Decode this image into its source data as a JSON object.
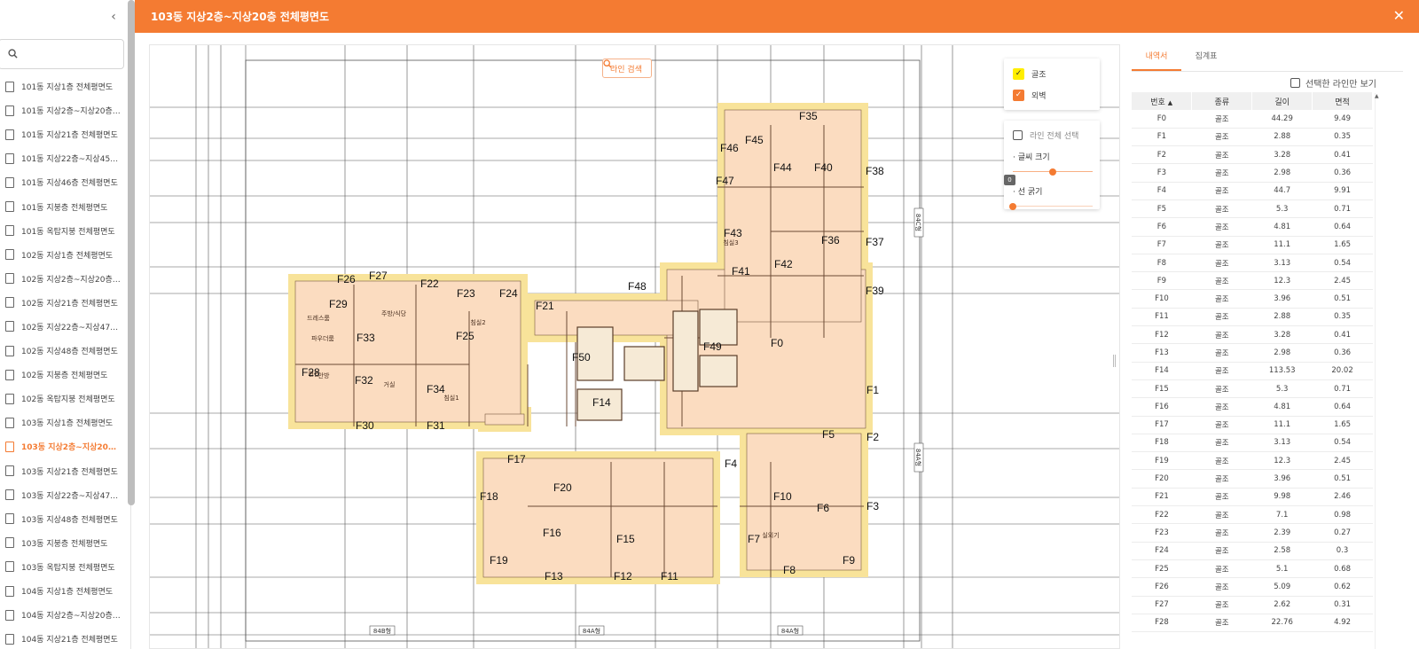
{
  "header": {
    "title": "103동 지상2층~지상20층 전체평면도",
    "close_icon": "close-icon"
  },
  "sidebar": {
    "collapse_icon": "chevron-left-icon",
    "search": {
      "placeholder": "",
      "value": ""
    },
    "items": [
      "101동 지상1층 전체평면도",
      "101동 지상2층~지상20층 전체평면도",
      "101동 지상21층 전체평면도",
      "101동 지상22층~지상45층 전체평면도",
      "101동 지상46층 전체평면도",
      "101동 지붕층 전체평면도",
      "101동 옥탑지붕 전체평면도",
      "102동 지상1층 전체평면도",
      "102동 지상2층~지상20층 전체평면도",
      "102동 지상21층 전체평면도",
      "102동 지상22층~지상47층 전체평면도",
      "102동 지상48층 전체평면도",
      "102동 지붕층 전체평면도",
      "102동 옥탑지붕 전체평면도",
      "103동 지상1층 전체평면도",
      "103동 지상2층~지상20층 전체평면도",
      "103동 지상21층 전체평면도",
      "103동 지상22층~지상47층 전체평면도",
      "103동 지상48층 전체평면도",
      "103동 지붕층 전체평면도",
      "103동 옥탑지붕 전체평면도",
      "104동 지상1층 전체평면도",
      "104동 지상2층~지상20층 전체평면도",
      "104동 지상21층 전체평면도"
    ],
    "active_index": 15
  },
  "drawing": {
    "line_search_label": "라인 검색",
    "legend": [
      {
        "label": "골조",
        "color": "#ffee00",
        "checked": true
      },
      {
        "label": "외벽",
        "color": "#f47b32",
        "checked": true
      }
    ],
    "select_all_label": "라인 전체 선택",
    "font_size_label": "· 글씨 크기",
    "font_size_value": 0.5,
    "line_width_label": "· 선 굵기",
    "line_width_value": 0,
    "line_width_tip": "0",
    "fill_color": "#fbdcc0",
    "frame_color": "#f8e39a",
    "unit_labels": [
      "84B형",
      "84A형",
      "84A형",
      "84C형",
      "84A형"
    ],
    "room_labels": [
      "주방/식당",
      "거실",
      "침실1",
      "침실2",
      "침실3",
      "현관",
      "드레스룸",
      "파우더룸",
      "안방",
      "실외기"
    ],
    "line_labels": [
      "F0",
      "F1",
      "F2",
      "F3",
      "F4",
      "F5",
      "F6",
      "F7",
      "F8",
      "F9",
      "F10",
      "F11",
      "F12",
      "F13",
      "F14",
      "F15",
      "F16",
      "F17",
      "F18",
      "F19",
      "F20",
      "F21",
      "F22",
      "F23",
      "F24",
      "F25",
      "F26",
      "F27",
      "F28",
      "F29",
      "F30",
      "F31",
      "F32",
      "F33",
      "F34",
      "F35",
      "F36",
      "F37",
      "F38",
      "F39",
      "F40",
      "F41",
      "F42",
      "F43",
      "F44",
      "F45",
      "F46",
      "F47",
      "F48",
      "F49",
      "F50"
    ]
  },
  "right_panel": {
    "tabs": [
      "내역서",
      "집계표"
    ],
    "active_tab": 0,
    "only_selected_label": "선택한 라인만 보기",
    "columns": [
      "번호",
      "종류",
      "길이",
      "면적"
    ],
    "sort_icon": "sort-asc-icon",
    "rows": [
      [
        "F0",
        "골조",
        "44.29",
        "9.49"
      ],
      [
        "F1",
        "골조",
        "2.88",
        "0.35"
      ],
      [
        "F2",
        "골조",
        "3.28",
        "0.41"
      ],
      [
        "F3",
        "골조",
        "2.98",
        "0.36"
      ],
      [
        "F4",
        "골조",
        "44.7",
        "9.91"
      ],
      [
        "F5",
        "골조",
        "5.3",
        "0.71"
      ],
      [
        "F6",
        "골조",
        "4.81",
        "0.64"
      ],
      [
        "F7",
        "골조",
        "11.1",
        "1.65"
      ],
      [
        "F8",
        "골조",
        "3.13",
        "0.54"
      ],
      [
        "F9",
        "골조",
        "12.3",
        "2.45"
      ],
      [
        "F10",
        "골조",
        "3.96",
        "0.51"
      ],
      [
        "F11",
        "골조",
        "2.88",
        "0.35"
      ],
      [
        "F12",
        "골조",
        "3.28",
        "0.41"
      ],
      [
        "F13",
        "골조",
        "2.98",
        "0.36"
      ],
      [
        "F14",
        "골조",
        "113.53",
        "20.02"
      ],
      [
        "F15",
        "골조",
        "5.3",
        "0.71"
      ],
      [
        "F16",
        "골조",
        "4.81",
        "0.64"
      ],
      [
        "F17",
        "골조",
        "11.1",
        "1.65"
      ],
      [
        "F18",
        "골조",
        "3.13",
        "0.54"
      ],
      [
        "F19",
        "골조",
        "12.3",
        "2.45"
      ],
      [
        "F20",
        "골조",
        "3.96",
        "0.51"
      ],
      [
        "F21",
        "골조",
        "9.98",
        "2.46"
      ],
      [
        "F22",
        "골조",
        "7.1",
        "0.98"
      ],
      [
        "F23",
        "골조",
        "2.39",
        "0.27"
      ],
      [
        "F24",
        "골조",
        "2.58",
        "0.3"
      ],
      [
        "F25",
        "골조",
        "5.1",
        "0.68"
      ],
      [
        "F26",
        "골조",
        "5.09",
        "0.62"
      ],
      [
        "F27",
        "골조",
        "2.62",
        "0.31"
      ],
      [
        "F28",
        "골조",
        "22.76",
        "4.92"
      ]
    ]
  }
}
